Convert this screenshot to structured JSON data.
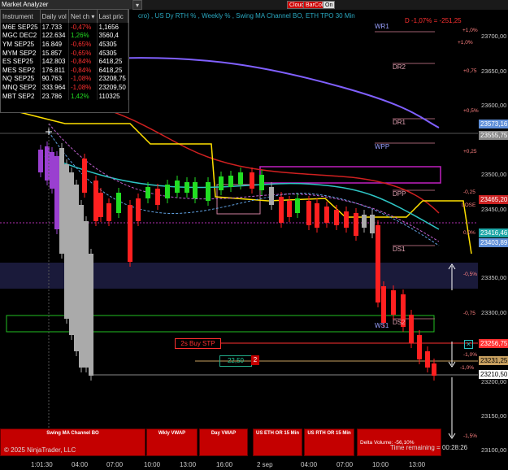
{
  "toolbar": {
    "header_text": "cro) , US Dy RTH % , Weekly % , Swing MA Channel BO, ETH TPO 30 Min",
    "btn_cloud": "Cloud",
    "btn_barcol": "BarCol",
    "btn_on": "On",
    "dropdown_arrow": "▾"
  },
  "market_analyzer": {
    "title": "Market Analyzer",
    "columns": [
      "Instrument",
      "Daily vol",
      "Net ch ▾",
      "Last pric"
    ],
    "rows": [
      {
        "instrument": "M6E SEP25",
        "daily_vol": "17.733",
        "net_change": "-0,47%",
        "last": "1,1656",
        "dir": "neg"
      },
      {
        "instrument": "MGC DEC2",
        "daily_vol": "122.634",
        "net_change": "1,26%",
        "last": "3560,4",
        "dir": "pos"
      },
      {
        "instrument": "YM SEP25",
        "daily_vol": "16.849",
        "net_change": "-0,65%",
        "last": "45305",
        "dir": "neg"
      },
      {
        "instrument": "MYM SEP2",
        "daily_vol": "15.857",
        "net_change": "-0,65%",
        "last": "45305",
        "dir": "neg"
      },
      {
        "instrument": "ES SEP25",
        "daily_vol": "142.803",
        "net_change": "-0,84%",
        "last": "6418,25",
        "dir": "neg"
      },
      {
        "instrument": "MES SEP2",
        "daily_vol": "176.811",
        "net_change": "-0,84%",
        "last": "6418,25",
        "dir": "neg"
      },
      {
        "instrument": "NQ SEP25",
        "daily_vol": "90.763",
        "net_change": "-1,08%",
        "last": "23208,75",
        "dir": "neg"
      },
      {
        "instrument": "MNQ SEP2",
        "daily_vol": "333.964",
        "net_change": "-1,08%",
        "last": "23209,50",
        "dir": "neg"
      },
      {
        "instrument": "MBT SEP2",
        "daily_vol": "23.786",
        "net_change": "1,42%",
        "last": "110325",
        "dir": "pos"
      }
    ]
  },
  "chart": {
    "daily_change_label": "D -1,07% = -251,25",
    "level_tags": [
      "WR1",
      "DR2",
      "DR1",
      "WPP",
      "DPP",
      "DS1",
      "DS2",
      "WS1"
    ],
    "percent_labels": [
      "+1,0%",
      "+1,0%",
      "+0,75",
      "+0,5%",
      "+0,25",
      "0,0%",
      "-0,5%",
      "-0,75",
      "-1,0%",
      "-1,0%",
      "-1,5%",
      "-0,25",
      "LOSE"
    ],
    "price_ticks": [
      "23700,00",
      "23650,00",
      "23600,00",
      "23500,00",
      "23450,00",
      "23350,00",
      "23300,00",
      "23200,00",
      "23150,00",
      "23100,00"
    ],
    "price_labels": [
      {
        "text": "23573,16",
        "color": "#5f8fd8"
      },
      {
        "text": "23555,75",
        "color": "#888888"
      },
      {
        "text": "23465,20",
        "color": "#cc2222"
      },
      {
        "text": "23416,46",
        "color": "#1ea7a7"
      },
      {
        "text": "23403,89",
        "color": "#5f8fd8"
      },
      {
        "text": "23256,75",
        "color": "#ff3030"
      },
      {
        "text": "23231,25",
        "color": "#c8a060"
      },
      {
        "text": "23210,50",
        "color": "#ffffff"
      }
    ],
    "order_label": "2s Buy STP",
    "order_qty": "22,50",
    "order_count": "2",
    "time_ticks": [
      "1:01:30",
      "04:00",
      "07:00",
      "10:00",
      "13:00",
      "16:00",
      "2 sep",
      "04:00",
      "07:00",
      "10:00",
      "13:00"
    ],
    "copyright": "© 2025 NinjaTrader, LLC",
    "delta_volume": "Delta Volume: -56,10%",
    "time_remaining": "Time remaining = 00:28:26",
    "close_icon": "x-icon"
  },
  "bottom_buttons": [
    "Swing MA Channel BO",
    "Wkly VWAP",
    "Day VWAP",
    "US ETH OR 15 Min",
    "US RTH OR 15 Min"
  ],
  "colors": {
    "accent": "#c40000",
    "ma_channel": "#ffe000",
    "teal": "#2ec4c4",
    "purple": "#9a3fd0",
    "up": "#22dd22",
    "down": "#ff2020"
  }
}
